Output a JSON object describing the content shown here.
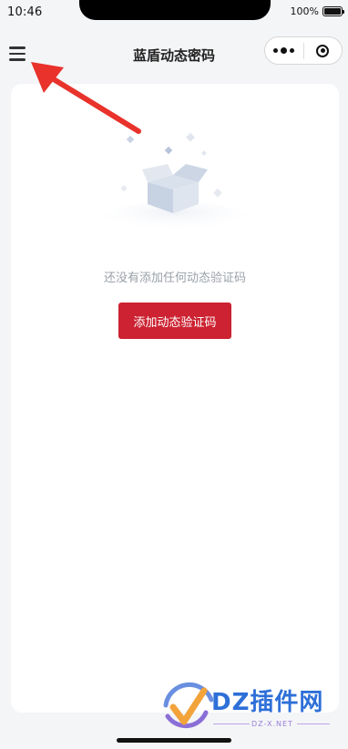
{
  "status_bar": {
    "time": "10:46",
    "battery_percent": "100%",
    "battery_level": 1.0
  },
  "nav": {
    "title": "蓝盾动态密码",
    "menu_icon": "hamburger-menu-icon",
    "more_icon": "more-dots-icon",
    "close_icon": "target-close-icon"
  },
  "main": {
    "empty_icon": "empty-box-icon",
    "empty_text": "还没有添加任何动态验证码",
    "add_button_label": "添加动态验证码",
    "add_button_color": "#cc2231"
  },
  "annotation": {
    "arrow_color": "#e8322b"
  },
  "watermark": {
    "brand": "DZ插件网",
    "sub": "DZ-X.NET"
  }
}
